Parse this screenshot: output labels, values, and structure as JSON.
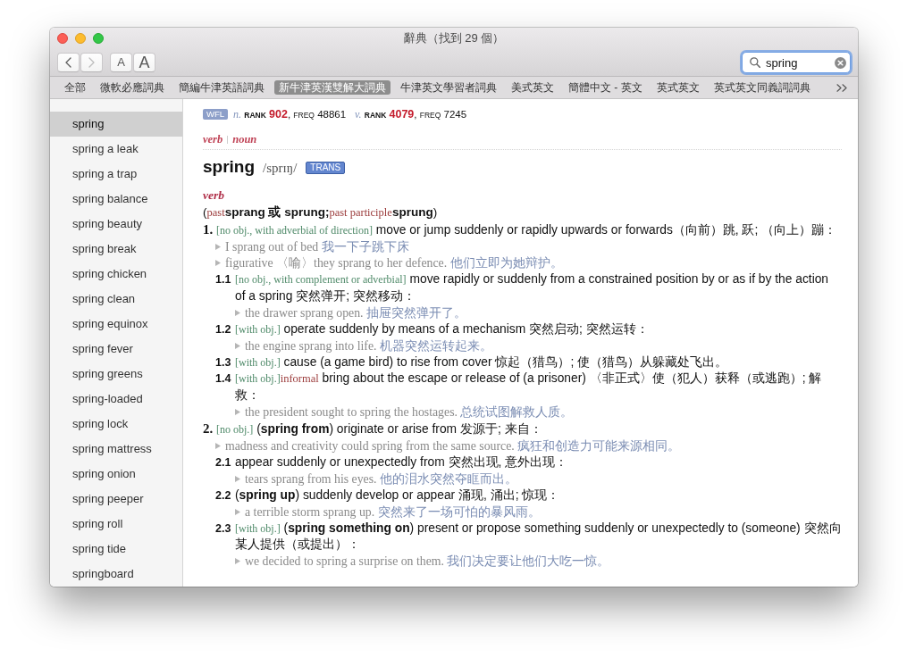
{
  "window": {
    "title": "辭典（找到 29 個）"
  },
  "toolbar": {
    "nav_buttons": [
      {
        "kind": "back",
        "disabled": false
      },
      {
        "kind": "forward",
        "disabled": true
      }
    ],
    "font_buttons": [
      {
        "label": "A",
        "kind": "smaller"
      },
      {
        "label": "A",
        "kind": "larger"
      }
    ],
    "search": {
      "value": "spring"
    }
  },
  "dictionary_tabs": [
    {
      "label": "全部",
      "selected": false
    },
    {
      "label": "微軟必應詞典",
      "selected": false
    },
    {
      "label": "簡編牛津英語詞典",
      "selected": false
    },
    {
      "label": "新牛津英漢雙解大詞典",
      "selected": true
    },
    {
      "label": "牛津英文學習者詞典",
      "selected": false
    },
    {
      "label": "美式英文",
      "selected": false
    },
    {
      "label": "簡體中文 - 英文",
      "selected": false
    },
    {
      "label": "英式英文",
      "selected": false
    },
    {
      "label": "英式英文同義詞詞典",
      "selected": false
    }
  ],
  "sidebar": {
    "items": [
      {
        "label": "spring",
        "selected": true
      },
      {
        "label": "spring a leak",
        "selected": false
      },
      {
        "label": "spring a trap",
        "selected": false
      },
      {
        "label": "spring balance",
        "selected": false
      },
      {
        "label": "spring beauty",
        "selected": false
      },
      {
        "label": "spring break",
        "selected": false
      },
      {
        "label": "spring chicken",
        "selected": false
      },
      {
        "label": "spring clean",
        "selected": false
      },
      {
        "label": "spring equinox",
        "selected": false
      },
      {
        "label": "spring fever",
        "selected": false
      },
      {
        "label": "spring greens",
        "selected": false
      },
      {
        "label": "spring-loaded",
        "selected": false
      },
      {
        "label": "spring lock",
        "selected": false
      },
      {
        "label": "spring mattress",
        "selected": false
      },
      {
        "label": "spring onion",
        "selected": false
      },
      {
        "label": "spring peeper",
        "selected": false
      },
      {
        "label": "spring roll",
        "selected": false
      },
      {
        "label": "spring tide",
        "selected": false
      },
      {
        "label": "springboard",
        "selected": false
      }
    ]
  },
  "entry": {
    "frequency": {
      "badge": "WFL",
      "items": [
        {
          "pos": "n.",
          "rank_label": "RANK",
          "rank": "902",
          "separator": ",",
          "freq_label": "FREQ",
          "freq": "48861"
        },
        {
          "pos": "v.",
          "rank_label": "RANK",
          "rank": "4079",
          "separator": ",",
          "freq_label": "FREQ",
          "freq": "7245"
        }
      ]
    },
    "pos_links": [
      "verb",
      "noun"
    ],
    "headword": "spring",
    "pronunciation": "/sprɪŋ/",
    "trans_badge": "TRANS",
    "sections": [
      {
        "pos": "verb",
        "inflections": [
          {
            "kind": "punct",
            "text": "("
          },
          {
            "kind": "label",
            "text": "past"
          },
          {
            "kind": "form",
            "text": "sprang 或 sprung;"
          },
          {
            "kind": "label",
            "text": "past participle"
          },
          {
            "kind": "form",
            "text": "sprung"
          },
          {
            "kind": "punct",
            "text": ")"
          }
        ],
        "senses": [
          {
            "number": "1.",
            "grammar": "[no obj., with adverbial of direction]",
            "definition": "move or jump suddenly or rapidly upwards or forwards（向前）跳, 跃; （向上）蹦：",
            "examples": [
              {
                "text": "I sprang out of bed",
                "translation": "我一下子跳下床"
              },
              {
                "text": "figurative 〈喻〉they sprang to her defence.",
                "translation": "他们立即为她辩护。"
              }
            ],
            "subsenses": [
              {
                "number": "1.1",
                "grammar": "[no obj., with complement or adverbial]",
                "definition": "move rapidly or suddenly from a constrained position by or as if by the action of a spring  突然弹开; 突然移动：",
                "examples": [
                  {
                    "text": "the drawer sprang open.",
                    "translation": "抽屉突然弹开了。"
                  }
                ]
              },
              {
                "number": "1.2",
                "grammar": "[with obj.]",
                "definition": "operate suddenly by means of a mechanism  突然启动; 突然运转：",
                "examples": [
                  {
                    "text": "the engine sprang into life.",
                    "translation": "机器突然运转起来。"
                  }
                ]
              },
              {
                "number": "1.3",
                "grammar": "[with obj.]",
                "definition": "cause (a game bird) to rise from cover  惊起（猎鸟）; 使（猎鸟）从躲藏处飞出。"
              },
              {
                "number": "1.4",
                "grammar": "[with obj.]",
                "register": "informal",
                "definition": "bring about the escape or release of (a prisoner)  〈非正式〉使（犯人）获释（或逃跑）; 解救：",
                "examples": [
                  {
                    "text": "the president sought to spring the hostages.",
                    "translation": "总统试图解救人质。"
                  }
                ]
              }
            ]
          },
          {
            "number": "2.",
            "grammar": "[no obj.]",
            "definition": "(**spring from**) originate or arise from  发源于; 来自：",
            "examples": [
              {
                "text": "madness and creativity could spring from the same source.",
                "translation": "疯狂和创造力可能来源相同。"
              }
            ],
            "subsenses": [
              {
                "number": "2.1",
                "definition": "appear suddenly or unexpectedly from  突然出现, 意外出现：",
                "examples": [
                  {
                    "text": "tears sprang from his eyes.",
                    "translation": "他的泪水突然夺眶而出。"
                  }
                ]
              },
              {
                "number": "2.2",
                "definition": "(**spring up**) suddenly develop or appear  涌现, 涌出; 惊现：",
                "examples": [
                  {
                    "text": "a terrible storm sprang up.",
                    "translation": "突然来了一场可怕的暴风雨。"
                  }
                ]
              },
              {
                "number": "2.3",
                "grammar": "[with obj.]",
                "definition": "(**spring something on**) present or propose something suddenly or unexpectedly to (someone)  突然向某人提供（或提出）：",
                "examples": [
                  {
                    "text": "we decided to spring a surprise on them.",
                    "translation": "我们决定要让他们大吃一惊。"
                  }
                ]
              }
            ]
          }
        ]
      }
    ]
  }
}
